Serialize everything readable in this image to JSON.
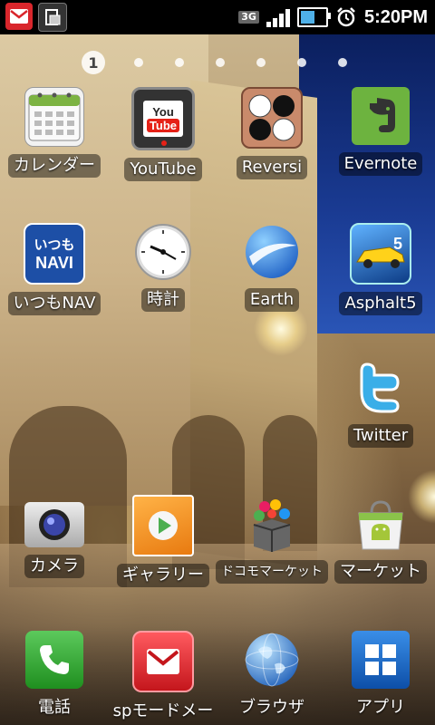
{
  "status_bar": {
    "network_type": "3G",
    "time": "5:20PM",
    "battery_level": 0.7,
    "signal_bars": 4,
    "icons": [
      "mail-notification-icon",
      "sync-notification-icon",
      "data-3g-icon",
      "signal-icon",
      "battery-icon",
      "alarm-icon"
    ]
  },
  "home": {
    "current_page": "1",
    "page_count": 7,
    "rows": [
      [
        {
          "label": "カレンダー",
          "icon": "calendar-icon"
        },
        {
          "label": "YouTube",
          "icon": "youtube-icon",
          "badge": "You Tube"
        },
        {
          "label": "Reversi",
          "icon": "reversi-icon"
        },
        {
          "label": "Evernote",
          "icon": "evernote-icon"
        }
      ],
      [
        {
          "label": "いつもNAV",
          "icon": "itsumo-navi-icon",
          "badge_top": "いつも",
          "badge_bottom": "NAVI"
        },
        {
          "label": "時計",
          "icon": "clock-icon"
        },
        {
          "label": "Earth",
          "icon": "google-earth-icon"
        },
        {
          "label": "Asphalt5",
          "icon": "asphalt5-icon"
        }
      ],
      [
        {
          "label": "",
          "icon": ""
        },
        {
          "label": "",
          "icon": ""
        },
        {
          "label": "",
          "icon": ""
        },
        {
          "label": "Twitter",
          "icon": "twitter-icon"
        }
      ],
      [
        {
          "label": "カメラ",
          "icon": "camera-icon"
        },
        {
          "label": "ギャラリー",
          "icon": "gallery-icon"
        },
        {
          "label": "ドコモマーケット",
          "icon": "docomo-market-icon"
        },
        {
          "label": "マーケット",
          "icon": "android-market-icon"
        }
      ]
    ]
  },
  "dock": [
    {
      "label": "電話",
      "icon": "phone-icon"
    },
    {
      "label": "spモードメー",
      "icon": "sp-mode-mail-icon"
    },
    {
      "label": "ブラウザ",
      "icon": "browser-globe-icon"
    },
    {
      "label": "アプリ",
      "icon": "app-drawer-icon"
    }
  ],
  "colors": {
    "status_bar_bg": "#000000",
    "mail_red": "#d9262c",
    "battery_blue": "#4fb0e8",
    "twitter_blue": "#3aaee8",
    "evernote_green": "#6db33f",
    "navi_blue": "#1d4fa6"
  }
}
